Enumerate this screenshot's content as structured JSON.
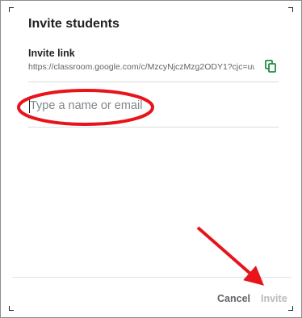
{
  "dialog": {
    "title": "Invite students",
    "invite_link": {
      "label": "Invite link",
      "url": "https://classroom.google.com/c/MzcyNjczMzg2ODY1?cjc=uws..."
    },
    "search": {
      "placeholder": "Type a name or email",
      "value": ""
    },
    "buttons": {
      "cancel": "Cancel",
      "invite": "Invite"
    }
  },
  "colors": {
    "copy_icon": "#1e8e3e",
    "annotation": "#e8141b",
    "disabled_text": "#b7b9bc"
  },
  "icons": {
    "copy": "copy-icon"
  }
}
